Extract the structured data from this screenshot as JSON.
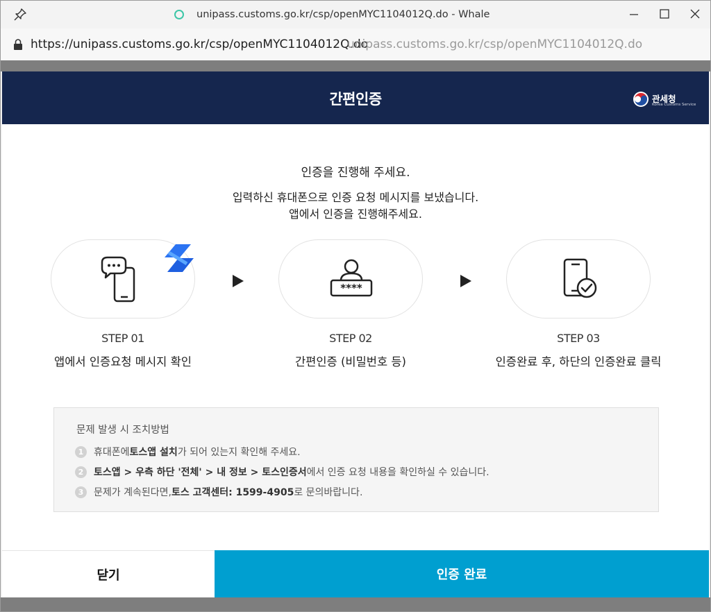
{
  "browser": {
    "window_title_url": "unipass.customs.go.kr/csp/openMYC1104012Q.do",
    "window_title_sep": "-",
    "app_name": "Whale",
    "address_url": "https://unipass.customs.go.kr/csp/openMYC1104012Q.do",
    "address_ghost": "unipass.customs.go.kr/csp/openMYC1104012Q.do",
    "icons": [
      "pin-icon",
      "whale-icon",
      "minimize-icon",
      "maximize-icon",
      "close-icon",
      "lock-icon"
    ]
  },
  "modal": {
    "title": "간편인증",
    "logo": {
      "name": "관세청",
      "subtitle": "Korea Customs Service"
    },
    "intro_line1": "인증을 진행해 주세요.",
    "intro_line2": "입력하신 휴대폰으로 인증 요청 메시지를 보냈습니다.",
    "intro_line3": "앱에서 인증을 진행해주세요.",
    "steps": [
      {
        "num": "STEP 01",
        "desc": "앱에서 인증요청 메시지 확인",
        "icon": "phone-message-icon"
      },
      {
        "num": "STEP 02",
        "desc": "간편인증 (비밀번호 등)",
        "icon": "user-password-icon"
      },
      {
        "num": "STEP 03",
        "desc": "인증완료 후, 하단의 인증완료 클릭",
        "icon": "phone-check-icon"
      }
    ],
    "trouble": {
      "title": "문제 발생 시 조치방법",
      "items": [
        {
          "n": "1",
          "a": "휴대폰에 ",
          "b": "토스앱 설치",
          "c": "가 되어 있는지 확인해 주세요."
        },
        {
          "n": "2",
          "a": "",
          "b": "토스앱 > 우측 하단 '전체' > 내 정보 > 토스인증서",
          "c": "에서 인증 요청 내용을 확인하실 수 있습니다."
        },
        {
          "n": "3",
          "a": "문제가 계속된다면, ",
          "b": "토스 고객센터: 1599-4905",
          "c": "로 문의바랍니다."
        }
      ]
    },
    "buttons": {
      "close": "닫기",
      "done": "인증 완료"
    },
    "colors": {
      "header": "#15264e",
      "primary": "#009fd0"
    }
  }
}
